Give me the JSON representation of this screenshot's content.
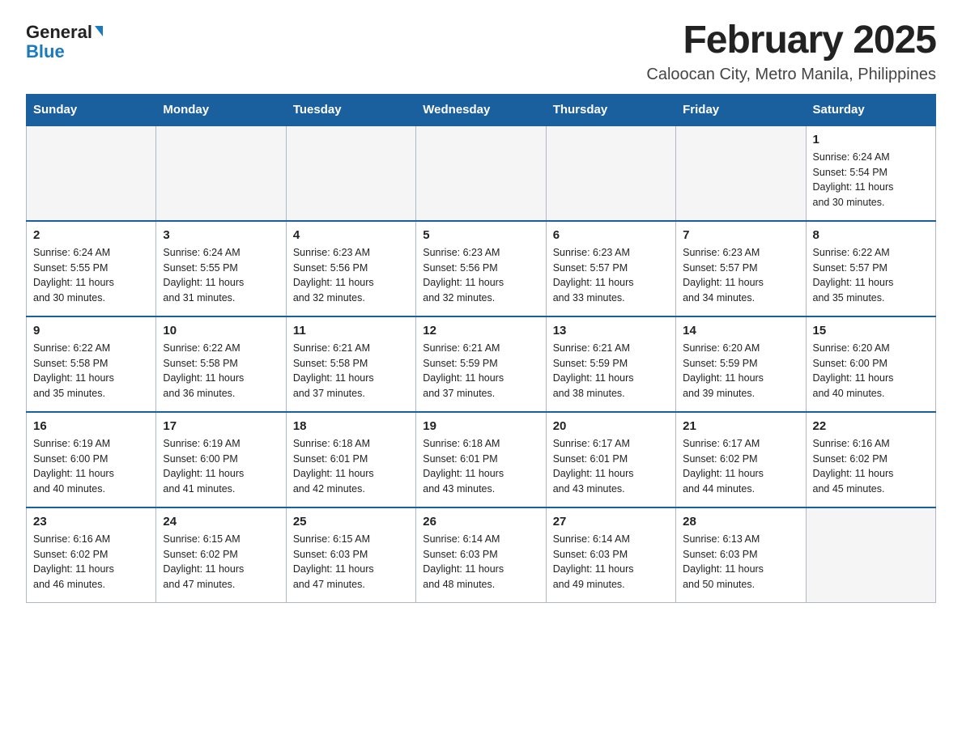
{
  "logo": {
    "general": "General",
    "blue": "Blue",
    "arrow": "▼"
  },
  "title": "February 2025",
  "subtitle": "Caloocan City, Metro Manila, Philippines",
  "days_of_week": [
    "Sunday",
    "Monday",
    "Tuesday",
    "Wednesday",
    "Thursday",
    "Friday",
    "Saturday"
  ],
  "weeks": [
    [
      {
        "day": "",
        "info": ""
      },
      {
        "day": "",
        "info": ""
      },
      {
        "day": "",
        "info": ""
      },
      {
        "day": "",
        "info": ""
      },
      {
        "day": "",
        "info": ""
      },
      {
        "day": "",
        "info": ""
      },
      {
        "day": "1",
        "info": "Sunrise: 6:24 AM\nSunset: 5:54 PM\nDaylight: 11 hours\nand 30 minutes."
      }
    ],
    [
      {
        "day": "2",
        "info": "Sunrise: 6:24 AM\nSunset: 5:55 PM\nDaylight: 11 hours\nand 30 minutes."
      },
      {
        "day": "3",
        "info": "Sunrise: 6:24 AM\nSunset: 5:55 PM\nDaylight: 11 hours\nand 31 minutes."
      },
      {
        "day": "4",
        "info": "Sunrise: 6:23 AM\nSunset: 5:56 PM\nDaylight: 11 hours\nand 32 minutes."
      },
      {
        "day": "5",
        "info": "Sunrise: 6:23 AM\nSunset: 5:56 PM\nDaylight: 11 hours\nand 32 minutes."
      },
      {
        "day": "6",
        "info": "Sunrise: 6:23 AM\nSunset: 5:57 PM\nDaylight: 11 hours\nand 33 minutes."
      },
      {
        "day": "7",
        "info": "Sunrise: 6:23 AM\nSunset: 5:57 PM\nDaylight: 11 hours\nand 34 minutes."
      },
      {
        "day": "8",
        "info": "Sunrise: 6:22 AM\nSunset: 5:57 PM\nDaylight: 11 hours\nand 35 minutes."
      }
    ],
    [
      {
        "day": "9",
        "info": "Sunrise: 6:22 AM\nSunset: 5:58 PM\nDaylight: 11 hours\nand 35 minutes."
      },
      {
        "day": "10",
        "info": "Sunrise: 6:22 AM\nSunset: 5:58 PM\nDaylight: 11 hours\nand 36 minutes."
      },
      {
        "day": "11",
        "info": "Sunrise: 6:21 AM\nSunset: 5:58 PM\nDaylight: 11 hours\nand 37 minutes."
      },
      {
        "day": "12",
        "info": "Sunrise: 6:21 AM\nSunset: 5:59 PM\nDaylight: 11 hours\nand 37 minutes."
      },
      {
        "day": "13",
        "info": "Sunrise: 6:21 AM\nSunset: 5:59 PM\nDaylight: 11 hours\nand 38 minutes."
      },
      {
        "day": "14",
        "info": "Sunrise: 6:20 AM\nSunset: 5:59 PM\nDaylight: 11 hours\nand 39 minutes."
      },
      {
        "day": "15",
        "info": "Sunrise: 6:20 AM\nSunset: 6:00 PM\nDaylight: 11 hours\nand 40 minutes."
      }
    ],
    [
      {
        "day": "16",
        "info": "Sunrise: 6:19 AM\nSunset: 6:00 PM\nDaylight: 11 hours\nand 40 minutes."
      },
      {
        "day": "17",
        "info": "Sunrise: 6:19 AM\nSunset: 6:00 PM\nDaylight: 11 hours\nand 41 minutes."
      },
      {
        "day": "18",
        "info": "Sunrise: 6:18 AM\nSunset: 6:01 PM\nDaylight: 11 hours\nand 42 minutes."
      },
      {
        "day": "19",
        "info": "Sunrise: 6:18 AM\nSunset: 6:01 PM\nDaylight: 11 hours\nand 43 minutes."
      },
      {
        "day": "20",
        "info": "Sunrise: 6:17 AM\nSunset: 6:01 PM\nDaylight: 11 hours\nand 43 minutes."
      },
      {
        "day": "21",
        "info": "Sunrise: 6:17 AM\nSunset: 6:02 PM\nDaylight: 11 hours\nand 44 minutes."
      },
      {
        "day": "22",
        "info": "Sunrise: 6:16 AM\nSunset: 6:02 PM\nDaylight: 11 hours\nand 45 minutes."
      }
    ],
    [
      {
        "day": "23",
        "info": "Sunrise: 6:16 AM\nSunset: 6:02 PM\nDaylight: 11 hours\nand 46 minutes."
      },
      {
        "day": "24",
        "info": "Sunrise: 6:15 AM\nSunset: 6:02 PM\nDaylight: 11 hours\nand 47 minutes."
      },
      {
        "day": "25",
        "info": "Sunrise: 6:15 AM\nSunset: 6:03 PM\nDaylight: 11 hours\nand 47 minutes."
      },
      {
        "day": "26",
        "info": "Sunrise: 6:14 AM\nSunset: 6:03 PM\nDaylight: 11 hours\nand 48 minutes."
      },
      {
        "day": "27",
        "info": "Sunrise: 6:14 AM\nSunset: 6:03 PM\nDaylight: 11 hours\nand 49 minutes."
      },
      {
        "day": "28",
        "info": "Sunrise: 6:13 AM\nSunset: 6:03 PM\nDaylight: 11 hours\nand 50 minutes."
      },
      {
        "day": "",
        "info": ""
      }
    ]
  ]
}
